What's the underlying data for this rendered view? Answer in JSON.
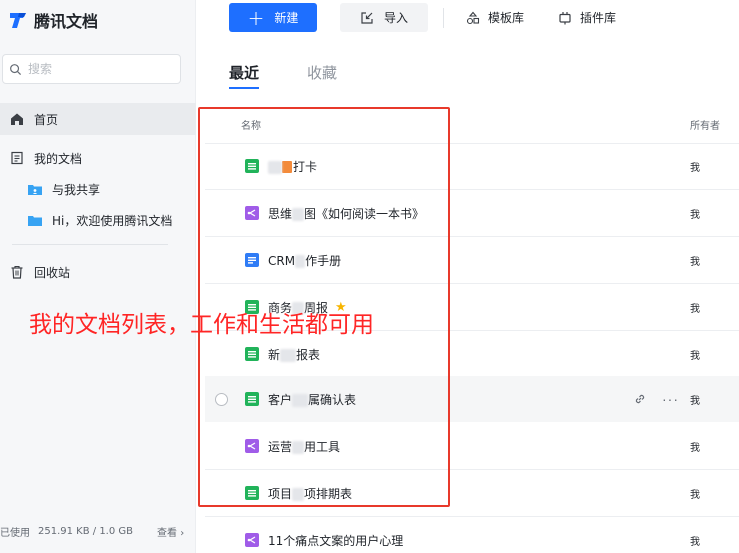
{
  "app": {
    "name": "腾讯文档"
  },
  "colors": {
    "accent": "#1e6fff",
    "annotation": "#ff2525",
    "sheet": "#21b35a",
    "doc": "#2f7cf6",
    "mind": "#a05ce8"
  },
  "search": {
    "placeholder": "搜索"
  },
  "sidebar": {
    "items": [
      {
        "label": "首页",
        "icon": "home-icon",
        "active": true
      },
      {
        "label": "我的文档",
        "icon": "document-icon"
      },
      {
        "label": "与我共享",
        "icon": "shared-folder-icon"
      },
      {
        "label": "Hi，欢迎使用腾讯文档",
        "icon": "folder-icon"
      },
      {
        "label": "回收站",
        "icon": "trash-icon"
      }
    ],
    "storage": {
      "used_label": "已使用",
      "used_value": "251.91 KB / 1.0 GB",
      "view_label": "查看 ›"
    }
  },
  "toolbar": {
    "new_label": "新建",
    "import_label": "导入",
    "templates_label": "模板库",
    "plugins_label": "插件库"
  },
  "tabs": [
    {
      "label": "最近",
      "active": true
    },
    {
      "label": "收藏"
    }
  ],
  "table": {
    "headers": {
      "name": "名称",
      "owner": "所有者"
    },
    "rows": [
      {
        "name_suffix": "打卡",
        "type": "sheet",
        "owner": "我"
      },
      {
        "name_prefix": "思维",
        "name_suffix": "图《如何阅读一本书》",
        "type": "mind",
        "owner": "我"
      },
      {
        "name_prefix": "CRM",
        "name_suffix": "作手册",
        "type": "doc",
        "owner": "我"
      },
      {
        "name_prefix": "商务",
        "name_suffix": "周报",
        "type": "sheet",
        "owner": "我",
        "starred": true
      },
      {
        "name_prefix": "新",
        "name_suffix": "报表",
        "type": "sheet",
        "owner": "我"
      },
      {
        "name_prefix": "客户",
        "name_suffix": "属确认表",
        "type": "sheet",
        "owner": "我",
        "hover": true
      },
      {
        "name_prefix": "运营",
        "name_suffix": "用工具",
        "type": "mind",
        "owner": "我"
      },
      {
        "name_prefix": "项目",
        "name_suffix": "项排期表",
        "type": "sheet",
        "owner": "我"
      },
      {
        "name": "11个痛点文案的用户心理",
        "type": "mind",
        "owner": "我"
      }
    ]
  },
  "annotation": {
    "text": "我的文档列表，工作和生活都可用"
  }
}
